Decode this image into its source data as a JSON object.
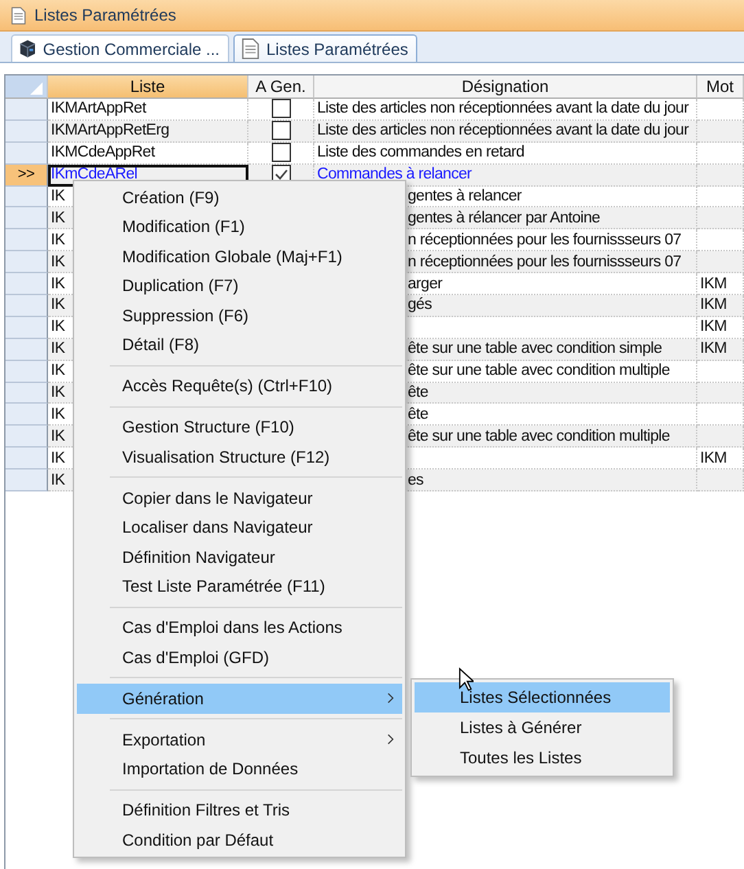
{
  "window": {
    "title": "Listes Paramétrées"
  },
  "tabs": [
    {
      "label": "Gestion Commerciale ...",
      "kind": "module",
      "selected": false
    },
    {
      "label": "Listes Paramétrées",
      "kind": "document",
      "selected": true
    }
  ],
  "table": {
    "columns": [
      {
        "label": "Liste",
        "selected": true
      },
      {
        "label": "A Gen.",
        "selected": false
      },
      {
        "label": "Désignation",
        "selected": false
      },
      {
        "label": "Mot",
        "selected": false
      }
    ],
    "rows": [
      {
        "liste": "IKMArtAppRet",
        "a_gen": false,
        "designation": "Liste des articles non réceptionnées avant la date du jour",
        "selected": false
      },
      {
        "liste": "IKMArtAppRetErg",
        "a_gen": false,
        "designation": "Liste des articles non réceptionnées avant la date du jour",
        "selected": false
      },
      {
        "liste": "IKMCdeAppRet",
        "a_gen": false,
        "designation": "Liste des commandes en retard",
        "selected": false
      },
      {
        "indicator": ">>",
        "liste": "IKmCdeARel",
        "a_gen": true,
        "designation": "Commandes à relancer",
        "selected": true
      },
      {
        "liste": "IK",
        "designation": "gentes à relancer",
        "selected": false
      },
      {
        "liste": "IK",
        "designation": "gentes à rélancer par Antoine",
        "selected": false
      },
      {
        "liste": "IK",
        "designation": "n réceptionnées pour les fournissseurs 07",
        "selected": false
      },
      {
        "liste": "IK",
        "designation": "n réceptionnées pour les fournissseurs 07",
        "selected": false
      },
      {
        "liste": "IK",
        "designation": "arger",
        "mot": "IKM",
        "selected": false
      },
      {
        "liste": "IK",
        "designation": "gés",
        "mot": "IKM",
        "selected": false
      },
      {
        "liste": "IK",
        "mot": "IKM",
        "selected": false
      },
      {
        "liste": "IK",
        "designation": "ête sur une table avec condition simple",
        "mot": "IKM",
        "selected": false
      },
      {
        "liste": "IK",
        "designation": "ête sur une table avec condition multiple",
        "selected": false
      },
      {
        "liste": "IK",
        "designation": "ête",
        "selected": false
      },
      {
        "liste": "IK",
        "designation": "ête",
        "selected": false
      },
      {
        "liste": "IK",
        "designation": "ête sur une table avec condition multiple",
        "selected": false
      },
      {
        "liste": "IK",
        "mot": "IKM",
        "selected": false
      },
      {
        "liste": "IK",
        "designation": "es",
        "selected": false
      }
    ]
  },
  "context_menu": {
    "groups": [
      [
        {
          "label": "Création (F9)",
          "selected": false,
          "has_submenu": false
        },
        {
          "label": "Modification (F1)",
          "selected": false,
          "has_submenu": false
        },
        {
          "label": "Modification Globale (Maj+F1)",
          "selected": false,
          "has_submenu": false
        },
        {
          "label": "Duplication (F7)",
          "selected": false,
          "has_submenu": false
        },
        {
          "label": "Suppression (F6)",
          "selected": false,
          "has_submenu": false
        },
        {
          "label": "Détail (F8)",
          "selected": false,
          "has_submenu": false
        }
      ],
      [
        {
          "label": "Accès Requête(s) (Ctrl+F10)",
          "selected": false,
          "has_submenu": false
        }
      ],
      [
        {
          "label": "Gestion Structure (F10)",
          "selected": false,
          "has_submenu": false
        },
        {
          "label": "Visualisation Structure (F12)",
          "selected": false,
          "has_submenu": false
        }
      ],
      [
        {
          "label": "Copier dans le Navigateur",
          "selected": false,
          "has_submenu": false
        },
        {
          "label": "Localiser dans Navigateur",
          "selected": false,
          "has_submenu": false
        },
        {
          "label": "Définition Navigateur",
          "selected": false,
          "has_submenu": false
        },
        {
          "label": "Test Liste Paramétrée (F11)",
          "selected": false,
          "has_submenu": false
        }
      ],
      [
        {
          "label": "Cas d'Emploi dans les Actions",
          "selected": false,
          "has_submenu": false
        },
        {
          "label": "Cas d'Emploi (GFD)",
          "selected": false,
          "has_submenu": false
        }
      ],
      [
        {
          "label": "Génération",
          "selected": true,
          "has_submenu": true
        }
      ],
      [
        {
          "label": "Exportation",
          "selected": false,
          "has_submenu": true
        },
        {
          "label": "Importation de Données",
          "selected": false,
          "has_submenu": false
        }
      ],
      [
        {
          "label": "Définition Filtres et Tris",
          "selected": false,
          "has_submenu": false
        },
        {
          "label": "Condition par Défaut",
          "selected": false,
          "has_submenu": false
        }
      ]
    ]
  },
  "submenu": {
    "items": [
      {
        "label": "Listes Sélectionnées",
        "selected": true
      },
      {
        "label": "Listes à Générer",
        "selected": false
      },
      {
        "label": "Toutes les Listes",
        "selected": false
      }
    ]
  }
}
